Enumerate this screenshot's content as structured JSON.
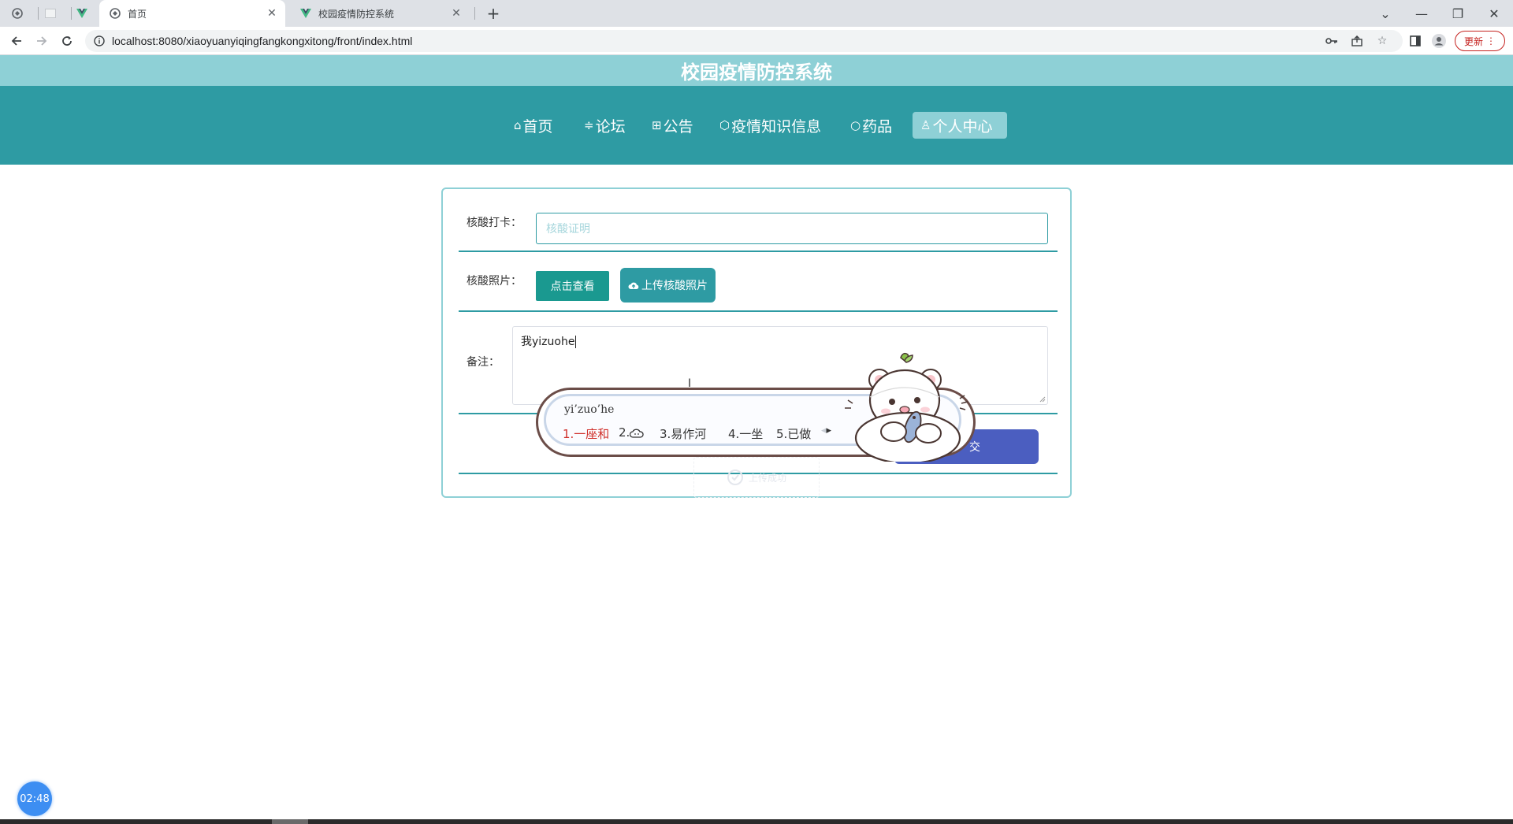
{
  "browser": {
    "tabs": [
      {
        "title": "",
        "icon": "globe-icon",
        "active": false
      },
      {
        "title": "",
        "icon": "blank-page-icon",
        "active": false
      },
      {
        "title": "",
        "icon": "vue-logo-icon",
        "active": false
      },
      {
        "title": "首页",
        "icon": "globe-icon",
        "active": true
      },
      {
        "title": "校园疫情防控系统",
        "icon": "vue-logo-icon",
        "active": false
      }
    ],
    "url": "localhost:8080/xiaoyuanyiqingfangkongxitong/front/index.html",
    "update_label": "更新"
  },
  "site": {
    "title": "校园疫情防控系统",
    "nav": [
      {
        "label": "首页",
        "icon": "home-icon"
      },
      {
        "label": "论坛",
        "icon": "sliders-icon"
      },
      {
        "label": "公告",
        "icon": "apps-icon"
      },
      {
        "label": "疫情知识信息",
        "icon": "cube-icon"
      },
      {
        "label": "药品",
        "icon": "circle-icon"
      },
      {
        "label": "个人中心",
        "icon": "user-icon",
        "active": true
      }
    ]
  },
  "form": {
    "nucleic_label": "核酸打卡：",
    "nucleic_placeholder": "核酸证明",
    "photo_label": "核酸照片：",
    "view_button": "点击查看",
    "upload_button": "上传核酸照片",
    "remark_label": "备注：",
    "remark_value": "我yizuohe",
    "submit_label": "交",
    "faded_upload_label": "上传成功"
  },
  "ime": {
    "pinyin": "yi’zuo’he",
    "candidates": [
      "1.一座和",
      "2.",
      "3.易作河",
      "4.一坐",
      "5.已做"
    ],
    "candidate2_icon": "cloud-emoji-icon",
    "selected_index": 0
  },
  "timer": "02:48"
}
